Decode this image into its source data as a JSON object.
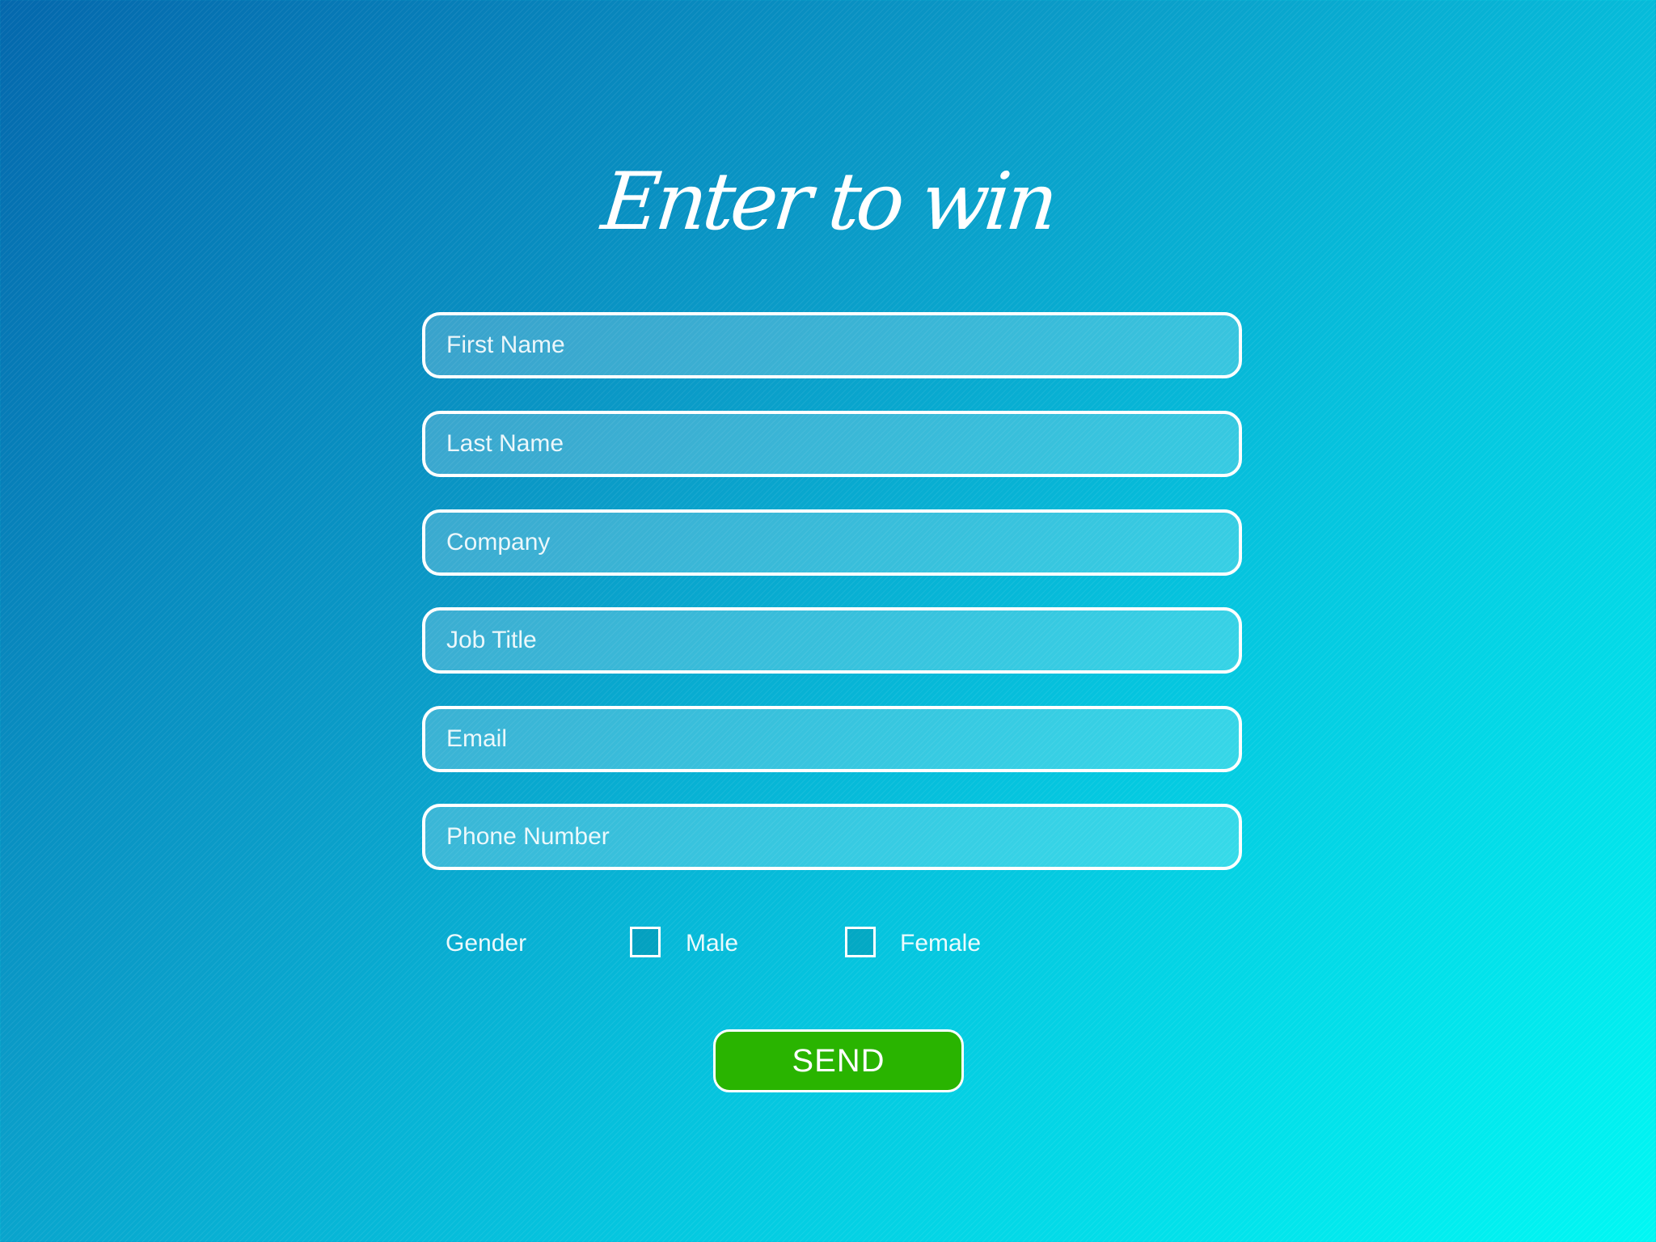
{
  "title": "Enter to win",
  "fields": [
    {
      "placeholder": "First Name"
    },
    {
      "placeholder": "Last Name"
    },
    {
      "placeholder": "Company"
    },
    {
      "placeholder": "Job Title"
    },
    {
      "placeholder": "Email"
    },
    {
      "placeholder": "Phone Number"
    }
  ],
  "gender": {
    "label": "Gender",
    "options": [
      {
        "label": "Male",
        "checked": false
      },
      {
        "label": "Female",
        "checked": false
      }
    ]
  },
  "submit_label": "SEND",
  "colors": {
    "background_start": "#0468ad",
    "background_end": "#00f8f4",
    "send_button": "#29b400",
    "border": "#ffffff"
  }
}
